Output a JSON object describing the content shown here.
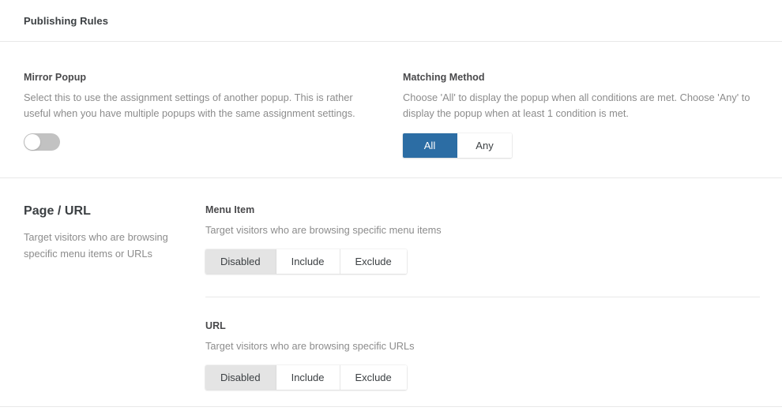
{
  "header": {
    "title": "Publishing Rules"
  },
  "top": {
    "mirror_popup": {
      "label": "Mirror Popup",
      "description": "Select this to use the assignment settings of another popup. This is rather useful when you have multiple popups with the same assignment settings.",
      "toggle": {
        "state": "off",
        "icon": "toggle-switch-off-icon"
      }
    },
    "matching_method": {
      "label": "Matching Method",
      "description": "Choose 'All' to display the popup when all conditions are met. Choose 'Any' to display the popup when at least 1 condition is met.",
      "options": [
        {
          "label": "All",
          "selected": true
        },
        {
          "label": "Any",
          "selected": false
        }
      ]
    }
  },
  "page_url_section": {
    "title": "Page / URL",
    "subtitle": "Target visitors who are browsing specific menu items or URLs",
    "fields": [
      {
        "label": "Menu Item",
        "description": "Target visitors who are browsing specific menu items",
        "options": [
          {
            "label": "Disabled",
            "selected": true
          },
          {
            "label": "Include",
            "selected": false
          },
          {
            "label": "Exclude",
            "selected": false
          }
        ]
      },
      {
        "label": "URL",
        "description": "Target visitors who are browsing specific URLs",
        "options": [
          {
            "label": "Disabled",
            "selected": true
          },
          {
            "label": "Include",
            "selected": false
          },
          {
            "label": "Exclude",
            "selected": false
          }
        ]
      }
    ]
  },
  "colors": {
    "accent_blue": "#2c6da4",
    "active_gray": "#e4e4e4",
    "divider": "#e8e8e8",
    "text_primary": "#3c4043",
    "text_muted": "#8c8c8c",
    "toggle_track_off": "#c2c2c2"
  }
}
